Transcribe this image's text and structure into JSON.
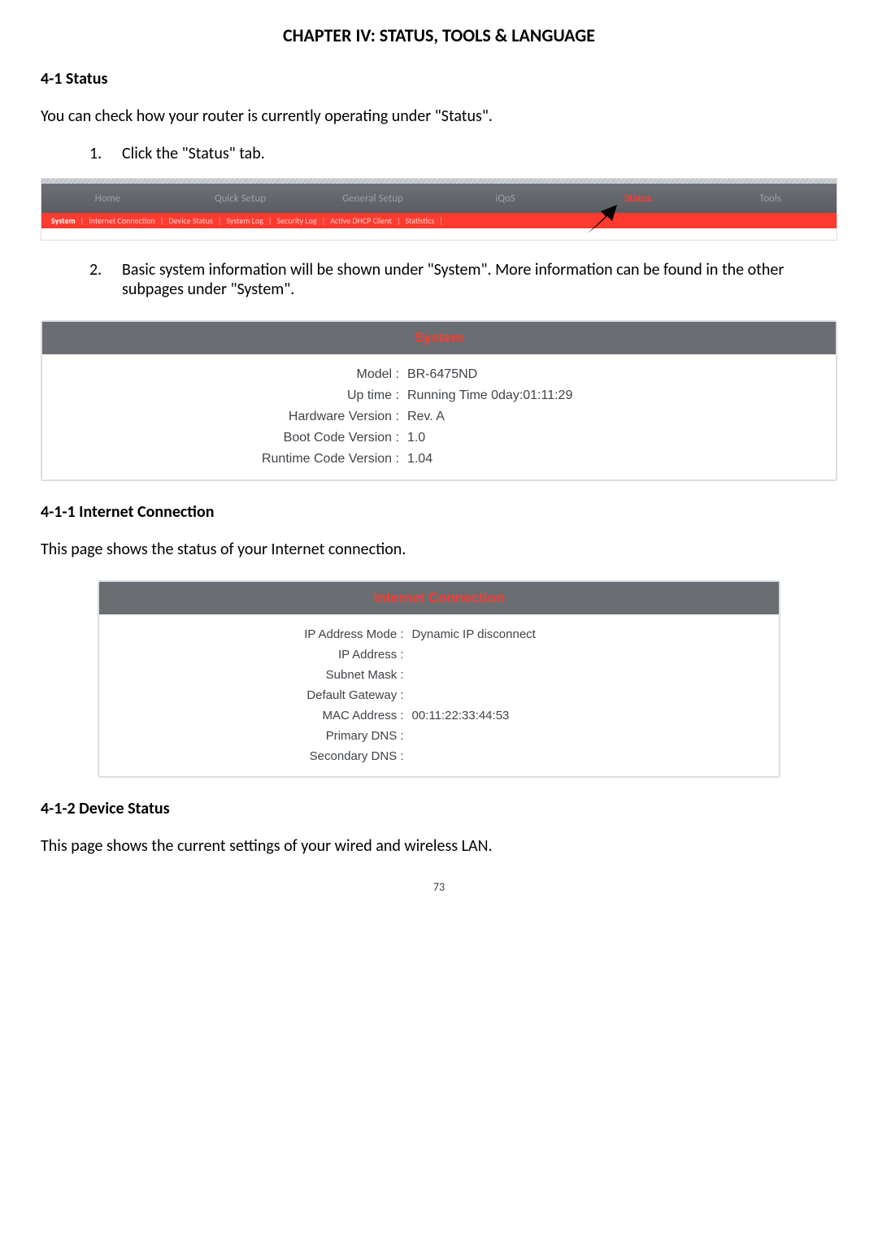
{
  "chapter_title": "CHAPTER IV: STATUS, TOOLS & LANGUAGE",
  "section_4_1": {
    "heading": "4-1 Status",
    "intro": "You can check how your router is currently operating under \"Status\".",
    "step1_num": "1.",
    "step1_text": "Click the \"Status\" tab.",
    "step2_num": "2.",
    "step2_text": "Basic system information will be shown under \"System\". More information can be found in the other subpages under \"System\"."
  },
  "router_nav": {
    "tabs": [
      "Home",
      "Quick Setup",
      "General Setup",
      "iQoS",
      "Status",
      "Tools"
    ],
    "active_tab_index": 4,
    "sub_tabs": [
      "System",
      "Internet Connection",
      "Device Status",
      "System Log",
      "Security Log",
      "Active DHCP Client",
      "Statistics"
    ],
    "active_sub_index": 0
  },
  "system_panel": {
    "title": "System",
    "rows": [
      {
        "label": "Model :",
        "value": "BR-6475ND"
      },
      {
        "label": "Up time :",
        "value": "Running Time 0day:01:11:29"
      },
      {
        "label": "Hardware Version :",
        "value": "Rev. A"
      },
      {
        "label": "Boot Code Version :",
        "value": "1.0"
      },
      {
        "label": "Runtime Code Version :",
        "value": "1.04"
      }
    ]
  },
  "section_4_1_1": {
    "heading": "4-1-1 Internet Connection",
    "intro": "This page shows the status of your Internet connection."
  },
  "internet_panel": {
    "title": "Internet Connection",
    "rows": [
      {
        "label": "IP Address Mode :",
        "value": "Dynamic IP disconnect"
      },
      {
        "label": "IP Address :",
        "value": ""
      },
      {
        "label": "Subnet Mask :",
        "value": ""
      },
      {
        "label": "Default Gateway :",
        "value": ""
      },
      {
        "label": "MAC Address :",
        "value": "00:11:22:33:44:53"
      },
      {
        "label": "Primary DNS :",
        "value": ""
      },
      {
        "label": "Secondary DNS :",
        "value": ""
      }
    ]
  },
  "section_4_1_2": {
    "heading": "4-1-2 Device Status",
    "intro": "This page shows the current settings of your wired and wireless LAN."
  },
  "page_number": "73"
}
